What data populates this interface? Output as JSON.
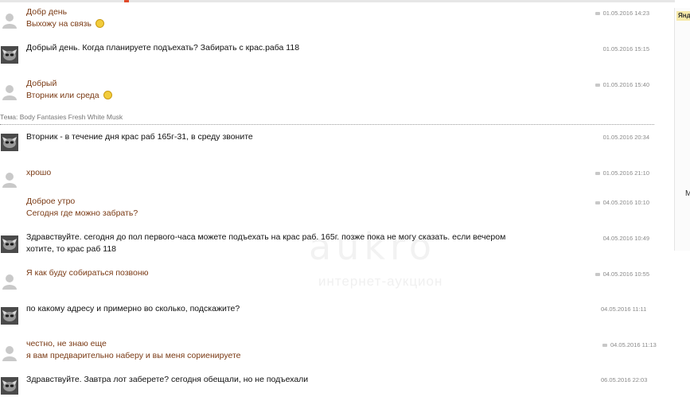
{
  "top_bar": {
    "accent_color": "#e04a2a"
  },
  "side_panel": {
    "ad_label": "Яндекс",
    "partial_letter": "М"
  },
  "watermark": {
    "logo": "aukro",
    "sub": "интернет-аукцион"
  },
  "theme_line": "Тема: Body Fantasies Fresh White Musk",
  "messages": [
    {
      "author": "me",
      "lines": [
        "Добр день",
        "Выхожу на связь"
      ],
      "smile": true,
      "date": "01.05.2016  14:23",
      "read": true
    },
    {
      "author": "them",
      "lines": [
        "Добрый день. Когда планируете подъехать? Забирать с крас.раба 118"
      ],
      "smile": false,
      "date": "01.05.2016  15:15",
      "read": false
    },
    {
      "author": "me",
      "lines": [
        "Добрый",
        "Вторник или среда"
      ],
      "smile": true,
      "date": "01.05.2016  15:40",
      "read": true
    },
    {
      "author": "them",
      "lines": [
        "Вторник - в течение дня крас раб 165г-31, в среду звоните"
      ],
      "smile": false,
      "date": "01.05.2016  20:34",
      "read": false
    },
    {
      "author": "me",
      "lines": [
        "хрошо"
      ],
      "smile": false,
      "date": "01.05.2016  21:10",
      "read": true
    },
    {
      "author": "me",
      "lines": [
        "Доброе утро",
        "Сегодня где можно забрать?"
      ],
      "smile": false,
      "date": "04.05.2016  10:10",
      "read": true
    },
    {
      "author": "them",
      "lines": [
        "Здравствуйте. сегодня до пол первого-часа можете подъехать на крас раб. 165г. позже пока не могу сказать. если вечером",
        "хотите, то крас раб 118"
      ],
      "smile": false,
      "date": "04.05.2016  10:49",
      "read": false
    },
    {
      "author": "me",
      "lines": [
        "Я как буду собираться позвоню"
      ],
      "smile": false,
      "date": "04.05.2016  10:55",
      "read": true
    },
    {
      "author": "them",
      "lines": [
        "по какому адресу и примерно во сколько, подскажите?"
      ],
      "smile": false,
      "date": "04.05.2016  11:11",
      "read": false
    },
    {
      "author": "me",
      "lines": [
        "честно, не знаю еще",
        "я вам предварительно наберу и вы меня сориенируете"
      ],
      "smile": false,
      "date": "04.05.2016  11:13",
      "read": true
    },
    {
      "author": "them",
      "lines": [
        "Здравствуйте. Завтра лот заберете? сегодня обещали, но не подъехали"
      ],
      "smile": false,
      "date": "06.05.2016  22:03",
      "read": false
    }
  ]
}
